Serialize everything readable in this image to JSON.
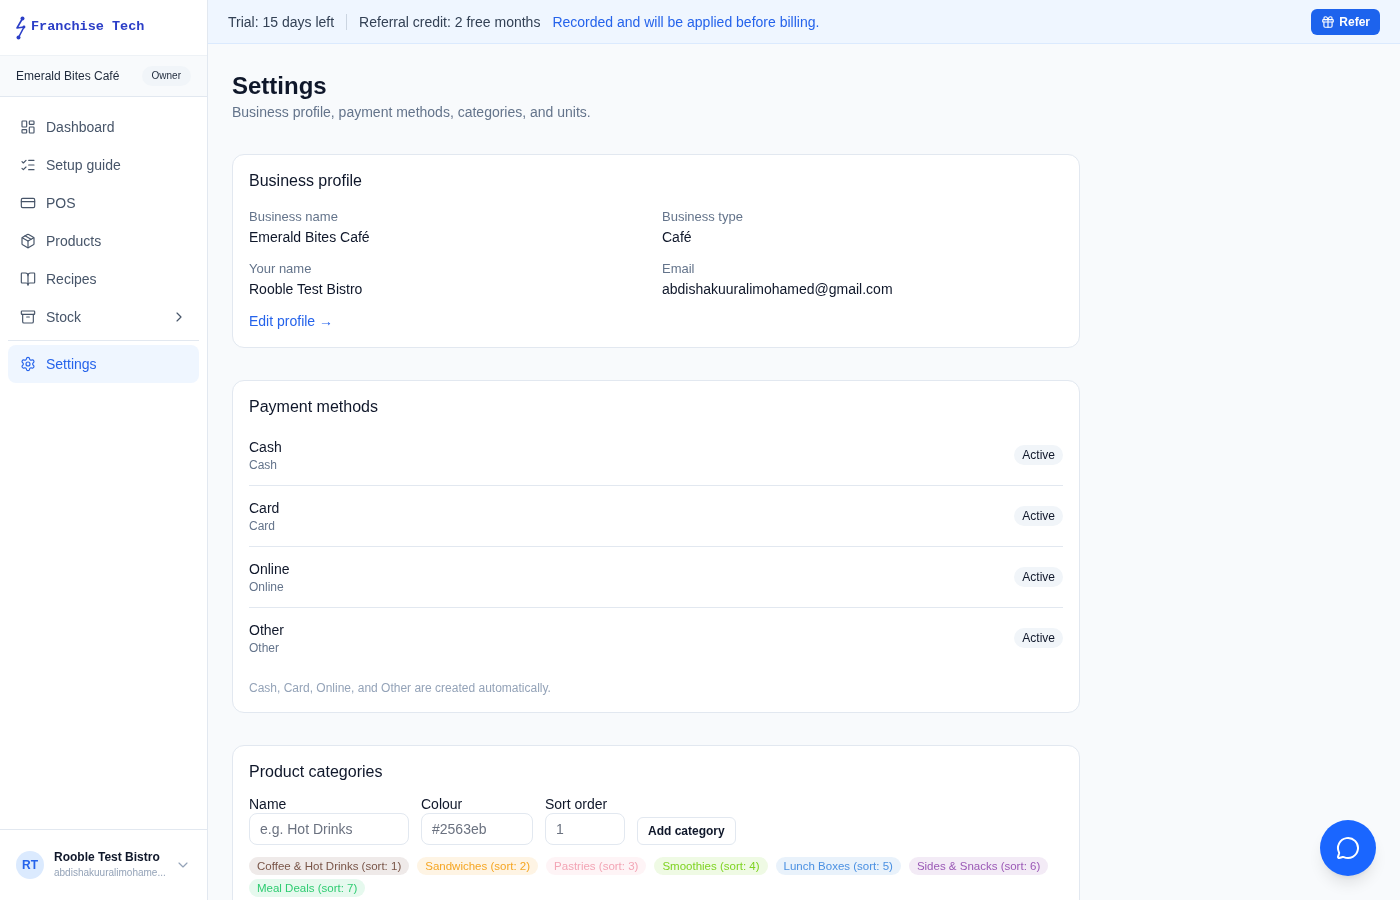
{
  "sidebar": {
    "logo": {
      "text": "Franchise Tech"
    },
    "organization": {
      "name": "Emerald Bites Café",
      "role": "Owner"
    },
    "nav_sections": [
      {
        "items": [
          {
            "label": "Dashboard",
            "kind": "link",
            "selected": false
          },
          {
            "label": "Setup guide",
            "kind": "link",
            "selected": false
          },
          {
            "label": "POS",
            "kind": "link",
            "selected": false
          },
          {
            "label": "Products",
            "kind": "link",
            "selected": false
          },
          {
            "label": "Recipes",
            "kind": "link",
            "selected": false
          },
          {
            "label": "Stock",
            "kind": "group",
            "expanded": false,
            "selected": false
          }
        ]
      },
      {
        "items": [
          {
            "label": "Settings",
            "kind": "link",
            "selected": true
          }
        ]
      }
    ],
    "user": {
      "initials": "RT",
      "name": "Rooble Test Bistro",
      "email": "abdishakuuralimohame..."
    }
  },
  "banner": {
    "trial": "Trial: 15 days left",
    "referral": "Referral credit: 2 free months",
    "note": "Recorded and will be applied before billing.",
    "button": "Refer"
  },
  "page": {
    "title": "Settings",
    "subtitle": "Business profile, payment methods, categories, and units."
  },
  "business_profile": {
    "title": "Business profile",
    "fields": [
      {
        "label": "Business name",
        "value": "Emerald Bites Café"
      },
      {
        "label": "Business type",
        "value": "Café"
      },
      {
        "label": "Your name",
        "value": "Rooble Test Bistro"
      },
      {
        "label": "Email",
        "value": "abdishakuuralimohamed@gmail.com"
      }
    ],
    "link": "Edit profile →"
  },
  "payment_methods": {
    "title": "Payment methods",
    "methods": [
      {
        "name": "Cash",
        "type": "Cash",
        "status": "Active"
      },
      {
        "name": "Card",
        "type": "Card",
        "status": "Active"
      },
      {
        "name": "Online",
        "type": "Online",
        "status": "Active"
      },
      {
        "name": "Other",
        "type": "Other",
        "status": "Active"
      }
    ],
    "note": "Cash, Card, Online, and Other are created automatically."
  },
  "product_categories": {
    "title": "Product categories",
    "form": {
      "fields": [
        {
          "label": "Name",
          "placeholder": "e.g. Hot Drinks"
        },
        {
          "label": "Colour",
          "placeholder": "#2563eb"
        },
        {
          "label": "Sort order",
          "placeholder": "1"
        }
      ],
      "button": "Add category"
    },
    "categories": [
      {
        "label": "Coffee & Hot Drinks (sort: 1)",
        "color": "#795548"
      },
      {
        "label": "Sandwiches (sort: 2)",
        "color": "#f5a623"
      },
      {
        "label": "Pastries (sort: 3)",
        "color": "#f3a5b5"
      },
      {
        "label": "Smoothies (sort: 4)",
        "color": "#7ed321"
      },
      {
        "label": "Lunch Boxes (sort: 5)",
        "color": "#4a90e2"
      },
      {
        "label": "Sides & Snacks (sort: 6)",
        "color": "#9b59b6"
      },
      {
        "label": "Meal Deals (sort: 7)",
        "color": "#2ecc71"
      }
    ]
  }
}
